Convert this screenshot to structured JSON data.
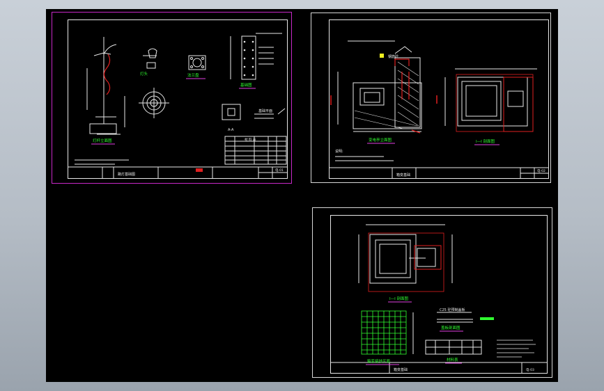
{
  "sheet1": {
    "labels": {
      "pole": "灯杆立面图",
      "lamp": "灯头",
      "flange": "法兰盘",
      "base": "基础图",
      "plan": "基础平面",
      "section": "A-A",
      "title_block": "路灯基础图",
      "sheet_no": "电-01",
      "table_head": "材 料 表"
    }
  },
  "sheet2": {
    "labels": {
      "elevation": "变电亭立面图",
      "section": "I—I 剖面图",
      "title_block": "箱变基础",
      "sheet_no": "电-02",
      "notes": "说明:",
      "label_a": "钢筋砼"
    }
  },
  "sheet3": {
    "labels": {
      "section": "I—I 剖面图",
      "grid": "箱变接地平面",
      "plate": "盖板剖面图",
      "table": "材料表",
      "title_block": "箱变基础",
      "sheet_no": "电-03",
      "plate_top": "C25 砼预制盖板"
    }
  },
  "colors": {
    "workspace": "#000000",
    "frame": "#e8e8e8",
    "selected_frame": "#c828c8",
    "accent_green": "#30ff30",
    "accent_red": "#e02020",
    "accent_magenta": "#e040e0",
    "accent_yellow": "#f0f020"
  }
}
